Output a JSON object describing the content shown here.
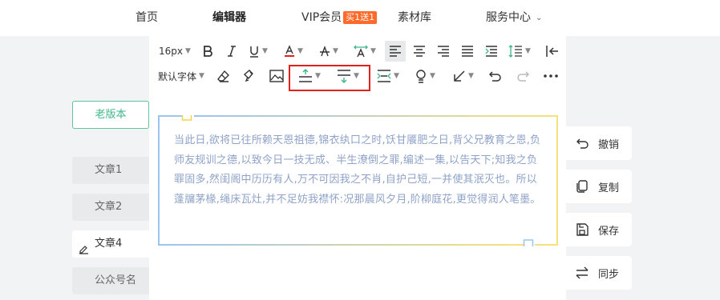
{
  "nav": {
    "home": "首页",
    "editor": "编辑器",
    "vip": "VIP会员",
    "vip_badge": "买1送1",
    "materials": "素材库",
    "service": "服务中心"
  },
  "toolbar": {
    "font_size": "16px",
    "default_font": "默认字体"
  },
  "sidebar": {
    "old_version": "老版本",
    "articles": [
      "文章1",
      "文章2",
      "文章4",
      "公众号名"
    ]
  },
  "content": {
    "text": "当此日,欲将已往所赖天恩祖德,锦衣纨口之时,饫甘餍肥之日,背父兄教育之恩,负师友规训之德,以致今日一技无成、半生潦倒之罪,编述一集,以告天下;知我之负罪固多,然闺阁中历历有人,万不可因我之不肖,自护己短,一并使其泯灭也。所以蓬牖茅椽,绳床瓦灶,并不足妨我襟怀:况那晨风夕月,阶柳庭花,更觉得润人笔墨。",
    "text_color": "#8fa3c8"
  },
  "actions": {
    "undo": "撤销",
    "copy": "复制",
    "save": "保存",
    "sync": "同步"
  },
  "colors": {
    "accent_green": "#3fb68b",
    "vip_orange": "#ff6a2a",
    "highlight_red": "#e0201a"
  }
}
